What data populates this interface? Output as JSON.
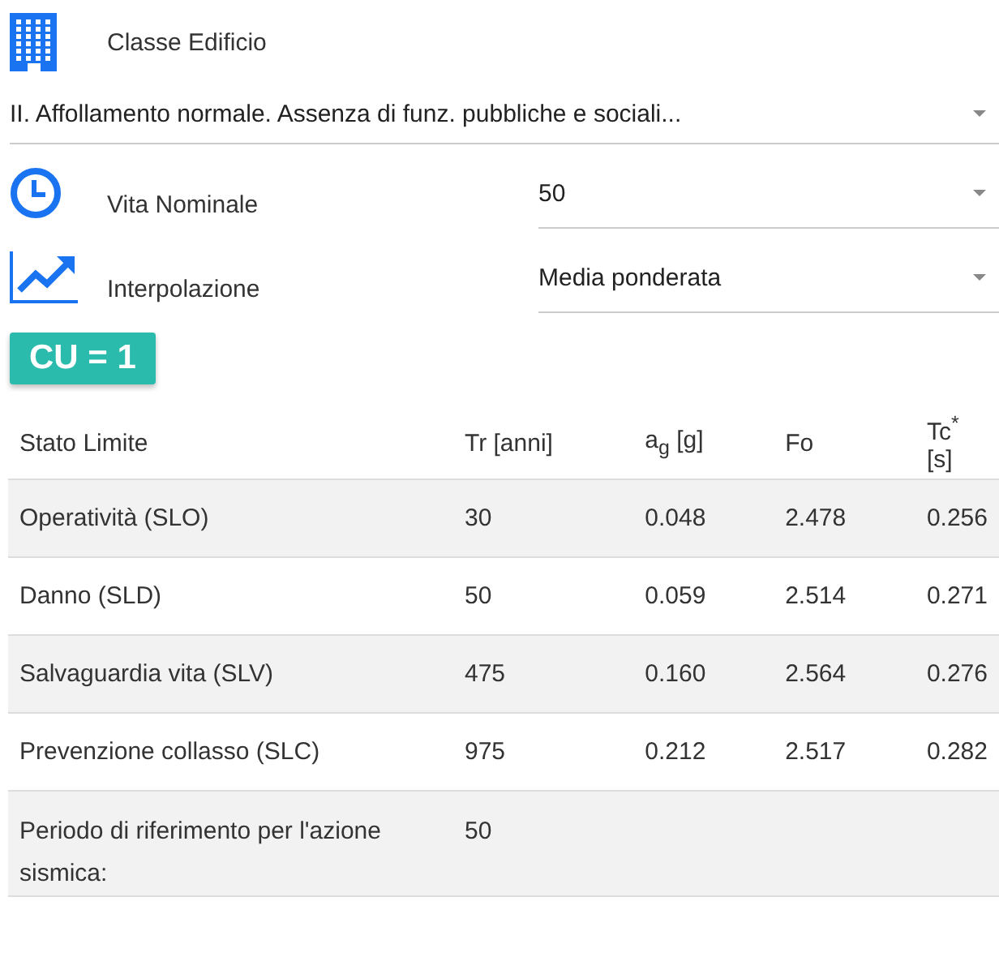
{
  "building_class": {
    "label": "Classe Edificio",
    "value": "II. Affollamento normale. Assenza di funz. pubbliche e sociali..."
  },
  "fields": [
    {
      "kind": "clock",
      "label": "Vita Nominale",
      "value": "50"
    },
    {
      "kind": "trend",
      "label": "Interpolazione",
      "value": "Media ponderata"
    }
  ],
  "badge": "CU = 1",
  "table": {
    "columns": [
      "Stato Limite",
      "Tr [anni]",
      "a$_{g}$ [g]",
      "Fo",
      "Tc$^{*}$ [s]"
    ],
    "rows": [
      [
        "Operatività (SLO)",
        "30",
        "0.048",
        "2.478",
        "0.256"
      ],
      [
        "Danno (SLD)",
        "50",
        "0.059",
        "2.514",
        "0.271"
      ],
      [
        "Salvaguardia vita (SLV)",
        "475",
        "0.160",
        "2.564",
        "0.276"
      ],
      [
        "Prevenzione collasso (SLC)",
        "975",
        "0.212",
        "2.517",
        "0.282"
      ],
      [
        "Periodo di riferimento per l'azione sismica:",
        "50"
      ]
    ]
  }
}
